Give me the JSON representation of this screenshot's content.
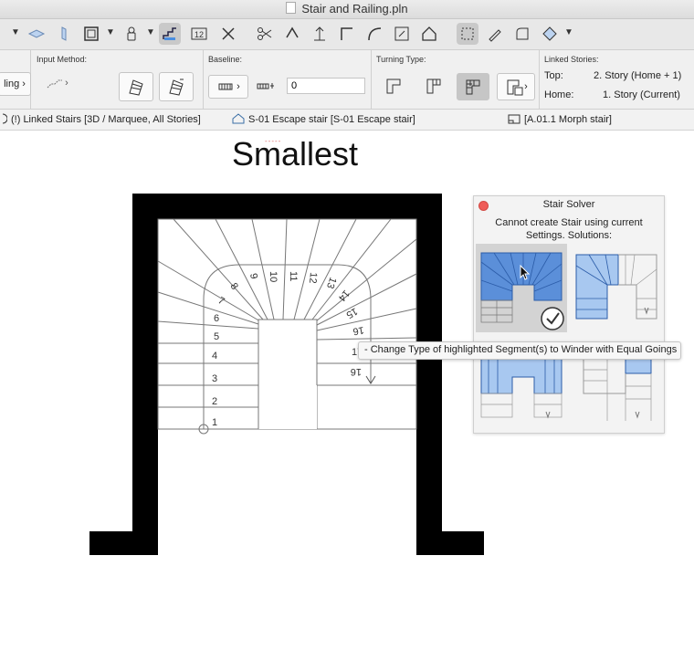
{
  "window": {
    "title": "Stair and Railing.pln"
  },
  "toolbar": {
    "icons": [
      "chevron-down-icon",
      "slab-icon",
      "curtain-wall-icon",
      "object-frame-icon",
      "chevron-down-icon",
      "lock-icon",
      "chevron-down-icon",
      "stair-tool-icon",
      "stair-number-icon",
      "cross-icon",
      "cut-icon",
      "trim-icon",
      "elevation-icon",
      "corner-icon",
      "curve-icon",
      "resize-icon",
      "house-icon",
      "select-icon",
      "brush-icon",
      "shape-icon",
      "morph-icon",
      "chevron-down-icon"
    ],
    "number_label": "12"
  },
  "infobox": {
    "railing_label": "ling",
    "input_method_label": "Input Method:",
    "baseline_label": "Baseline:",
    "baseline_value": "0",
    "turning_type_label": "Turning Type:",
    "linked_stories_label": "Linked Stories:",
    "top_label": "Top:",
    "top_value": "2. Story (Home + 1)",
    "home_label": "Home:",
    "home_value": "1. Story (Current)"
  },
  "tabs": [
    {
      "label": "(!) Linked Stairs [3D / Marquee, All Stories]"
    },
    {
      "label": "S-01 Escape stair [S-01 Escape stair]"
    },
    {
      "label": "[A.01.1 Morph stair]"
    }
  ],
  "canvas": {
    "title": "Smallest",
    "red_mark": "-----",
    "step_numbers": [
      "1",
      "2",
      "3",
      "4",
      "5",
      "6",
      "7",
      "8",
      "9",
      "10",
      "11",
      "12",
      "13",
      "14",
      "15",
      "16"
    ],
    "end_marks": [
      "17",
      "16"
    ]
  },
  "stair_solver": {
    "title": "Stair Solver",
    "message": "Cannot create Stair using current Settings. Solutions:",
    "solutions": [
      "solution-1",
      "solution-2",
      "solution-3",
      "solution-4"
    ],
    "tooltip": "- Change Type of highlighted Segment(s) to Winder with Equal Goings"
  },
  "colors": {
    "accent_blue": "#4a8ee0",
    "wall": "#000000",
    "close_red": "#ef5c58"
  }
}
